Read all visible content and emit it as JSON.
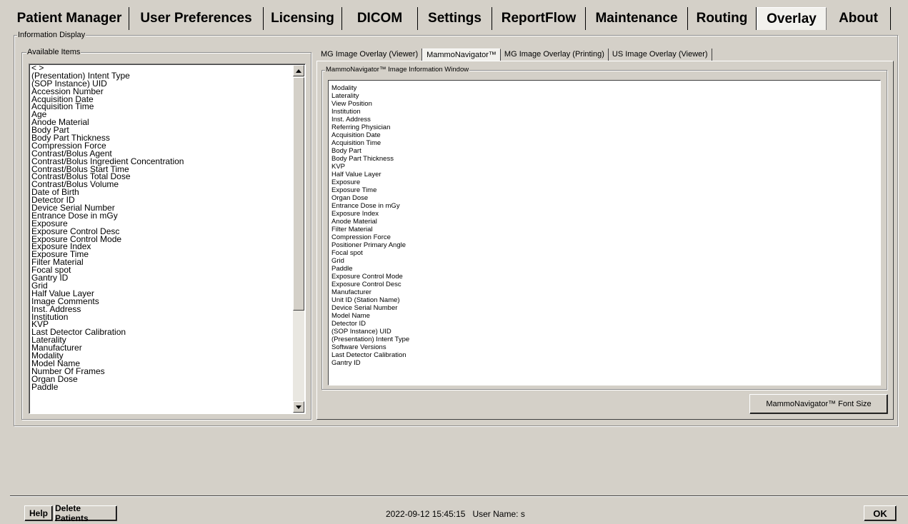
{
  "main_tabs": [
    {
      "label": "Patient Manager",
      "active": false
    },
    {
      "label": "User Preferences",
      "active": false
    },
    {
      "label": "Licensing",
      "active": false
    },
    {
      "label": "DICOM",
      "active": false
    },
    {
      "label": "Settings",
      "active": false
    },
    {
      "label": "ReportFlow",
      "active": false
    },
    {
      "label": "Maintenance",
      "active": false
    },
    {
      "label": "Routing",
      "active": false
    },
    {
      "label": "Overlay",
      "active": true
    },
    {
      "label": "About",
      "active": false
    }
  ],
  "info_display": {
    "legend": "Information Display"
  },
  "available_items": {
    "legend": "Available Items",
    "items": [
      "< >",
      "(Presentation) Intent Type",
      "(SOP Instance) UID",
      "Accession Number",
      "Acquisition Date",
      "Acquisition Time",
      "Age",
      "Anode Material",
      "Body Part",
      "Body Part Thickness",
      "Compression Force",
      "Contrast/Bolus Agent",
      "Contrast/Bolus Ingredient Concentration",
      "Contrast/Bolus Start Time",
      "Contrast/Bolus Total Dose",
      "Contrast/Bolus Volume",
      "Date of Birth",
      "Detector ID",
      "Device Serial Number",
      "Entrance Dose in mGy",
      "Exposure",
      "Exposure Control Desc",
      "Exposure Control Mode",
      "Exposure Index",
      "Exposure Time",
      "Filter Material",
      "Focal spot",
      "Gantry ID",
      "Grid",
      "Half Value Layer",
      "Image Comments",
      "Inst. Address",
      "Institution",
      "KVP",
      "Last Detector Calibration",
      "Laterality",
      "Manufacturer",
      "Modality",
      "Model Name",
      "Number Of Frames",
      "Organ Dose",
      "Paddle"
    ]
  },
  "sub_tabs": [
    {
      "label": "MG Image Overlay (Viewer)",
      "active": false
    },
    {
      "label": "MammoNavigator™",
      "active": true
    },
    {
      "label": "MG Image Overlay (Printing)",
      "active": false
    },
    {
      "label": "US Image Overlay (Viewer)",
      "active": false
    }
  ],
  "mammo_window": {
    "legend": "MammoNavigator™ Image Information Window",
    "items": [
      "Modality",
      "Laterality",
      "View Position",
      "Institution",
      "Inst. Address",
      "Referring Physician",
      "Acquisition Date",
      "Acquisition Time",
      "Body Part",
      "Body Part Thickness",
      "KVP",
      "Half Value Layer",
      "Exposure",
      "Exposure Time",
      "Organ Dose",
      "Entrance Dose in mGy",
      "Exposure Index",
      "Anode Material",
      "Filter Material",
      "Compression Force",
      "Positioner Primary Angle",
      "Focal spot",
      "Grid",
      "Paddle",
      "Exposure Control Mode",
      "Exposure Control Desc",
      "Manufacturer",
      "Unit ID (Station Name)",
      "Device Serial Number",
      "Model Name",
      "Detector ID",
      "(SOP Instance) UID",
      "(Presentation) Intent Type",
      "Software Versions",
      "Last Detector Calibration",
      "Gantry ID"
    ]
  },
  "font_size_button": "MammoNavigator™ Font Size",
  "footer": {
    "help": "Help",
    "delete_patients": "Delete Patients",
    "datetime": "2022-09-12 15:45:15",
    "user_label": "User Name:",
    "user_name": "s",
    "ok": "OK"
  }
}
